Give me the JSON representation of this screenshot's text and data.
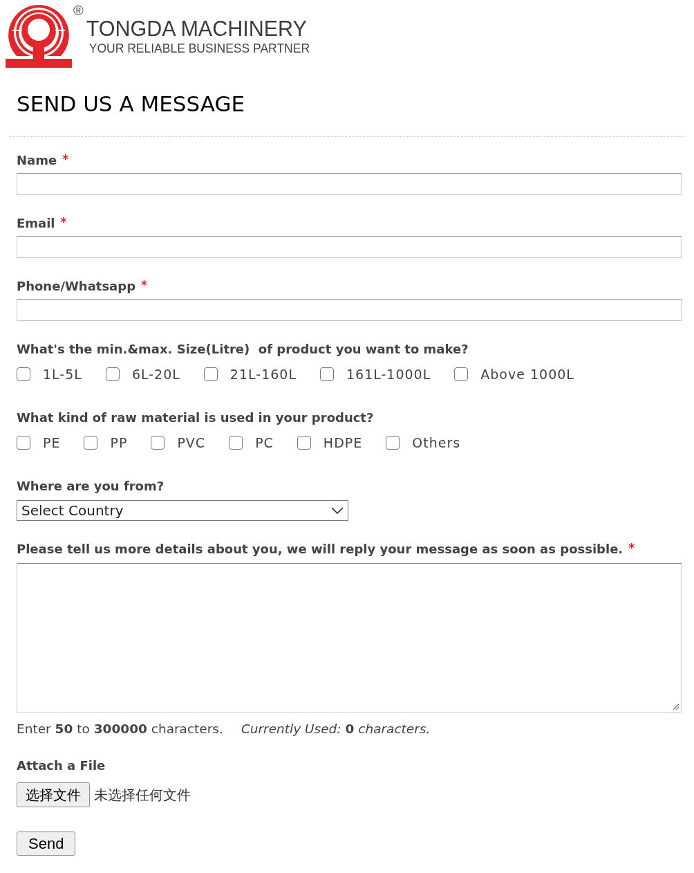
{
  "logo": {
    "registered_mark": "®",
    "brand": "TONGDA MACHINERY",
    "tagline": "YOUR RELIABLE BUSINESS PARTNER"
  },
  "heading": "SEND US A MESSAGE",
  "form": [
    {
      "kind": "text",
      "label": "Name",
      "required_mark": "*"
    },
    {
      "kind": "text",
      "label": "Email",
      "required_mark": "*"
    },
    {
      "kind": "text",
      "label": "Phone/Whatsapp",
      "required_mark": "*"
    },
    {
      "kind": "checkboxes",
      "label": "What's the min.&max. Size(Litre)  of product you want to make?",
      "options": [
        {
          "label": "1L-5L",
          "checked": false
        },
        {
          "label": "6L-20L",
          "checked": false
        },
        {
          "label": "21L-160L",
          "checked": false
        },
        {
          "label": "161L-1000L",
          "checked": false
        },
        {
          "label": "Above 1000L",
          "checked": false
        }
      ]
    },
    {
      "kind": "checkboxes",
      "label": "What kind of raw material is used in your product?",
      "options": [
        {
          "label": "PE",
          "checked": false
        },
        {
          "label": "PP",
          "checked": false
        },
        {
          "label": "PVC",
          "checked": false
        },
        {
          "label": "PC",
          "checked": false
        },
        {
          "label": "HDPE",
          "checked": false
        },
        {
          "label": "Others",
          "checked": false
        }
      ]
    },
    {
      "kind": "select",
      "label": "Where are you from?",
      "value": "Select Country"
    },
    {
      "kind": "textarea",
      "label": "Please tell us more details about you, we will reply your message as soon as possible.",
      "required_mark": "*",
      "hint": "Enter **50** to **300000** characters.",
      "counter": "*Currently Used:* **0** *characters.*"
    },
    {
      "kind": "file",
      "label": "Attach a File",
      "button": "选择文件",
      "status": "未选择任何文件"
    }
  ],
  "submit": "Send"
}
